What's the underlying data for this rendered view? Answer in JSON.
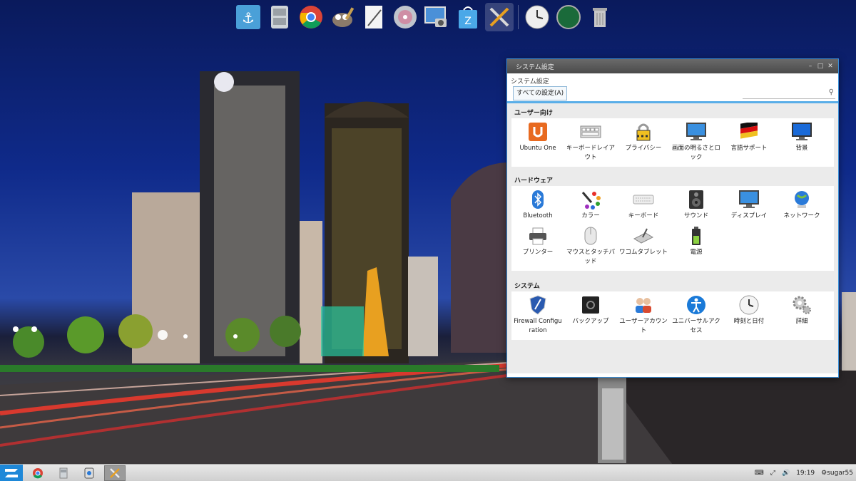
{
  "window": {
    "title": "システム設定",
    "breadcrumb": "システム設定",
    "all_settings_label": "すべての設定(A)",
    "search_placeholder": ""
  },
  "sections": [
    {
      "title": "ユーザー向け",
      "items": [
        {
          "label": "Ubuntu One",
          "icon": "ubuntu-one-icon"
        },
        {
          "label": "キーボードレイアウト",
          "icon": "keyboard-layout-icon"
        },
        {
          "label": "プライバシー",
          "icon": "privacy-lock-icon"
        },
        {
          "label": "画面の明るさとロック",
          "icon": "brightness-lock-icon"
        },
        {
          "label": "言語サポート",
          "icon": "language-flag-icon"
        },
        {
          "label": "背景",
          "icon": "background-monitor-icon"
        }
      ]
    },
    {
      "title": "ハードウェア",
      "items": [
        {
          "label": "Bluetooth",
          "icon": "bluetooth-icon"
        },
        {
          "label": "カラー",
          "icon": "color-palette-icon"
        },
        {
          "label": "キーボード",
          "icon": "keyboard-icon"
        },
        {
          "label": "サウンド",
          "icon": "speaker-icon"
        },
        {
          "label": "ディスプレイ",
          "icon": "display-icon"
        },
        {
          "label": "ネットワーク",
          "icon": "network-globe-icon"
        },
        {
          "label": "プリンター",
          "icon": "printer-icon"
        },
        {
          "label": "マウスとタッチパッド",
          "icon": "mouse-icon"
        },
        {
          "label": "ワコムタブレット",
          "icon": "wacom-tablet-icon"
        },
        {
          "label": "電源",
          "icon": "battery-icon"
        }
      ]
    },
    {
      "title": "システム",
      "items": [
        {
          "label": "Firewall Configuration",
          "icon": "firewall-shield-icon"
        },
        {
          "label": "バックアップ",
          "icon": "backup-safe-icon"
        },
        {
          "label": "ユーザーアカウント",
          "icon": "user-accounts-icon"
        },
        {
          "label": "ユニバーサルアクセス",
          "icon": "universal-access-icon"
        },
        {
          "label": "時刻と日付",
          "icon": "clock-icon"
        },
        {
          "label": "詳細",
          "icon": "details-gears-icon"
        }
      ]
    }
  ],
  "dock": [
    {
      "name": "anchor-app-icon"
    },
    {
      "name": "file-manager-icon"
    },
    {
      "name": "chrome-icon"
    },
    {
      "name": "gimp-icon"
    },
    {
      "name": "text-editor-icon"
    },
    {
      "name": "disc-burner-icon"
    },
    {
      "name": "screenshot-icon"
    },
    {
      "name": "software-store-icon"
    },
    {
      "name": "system-settings-icon"
    },
    {
      "name": "clock-app-icon"
    },
    {
      "name": "green-orb-icon"
    },
    {
      "name": "trash-icon"
    }
  ],
  "taskbar": {
    "apps": [
      "chrome-icon",
      "file-manager-icon",
      "screenshot-icon",
      "system-settings-icon"
    ],
    "time": "19:19",
    "user": "sugar55"
  },
  "colors": {
    "accent": "#1e88d8",
    "window_border": "#3a8fd8",
    "titlebar": "#555555"
  }
}
